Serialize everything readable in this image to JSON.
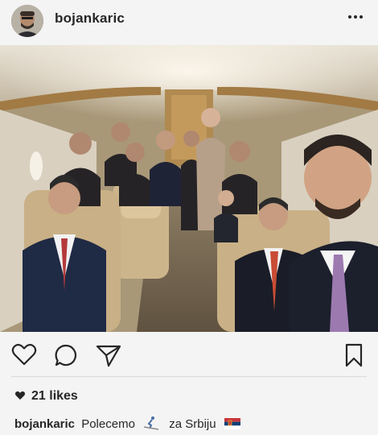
{
  "post": {
    "username": "bojankaric",
    "more_icon": "ellipsis-icon",
    "likes_text": "21 likes",
    "caption_user": "bojankaric",
    "caption_text_1": "Polecemo",
    "caption_text_2": "za Srbiju",
    "caption_emoji_1": "skier-icon",
    "caption_emoji_2": "serbian-flag-icon"
  },
  "actions": {
    "like_icon": "heart-outline-icon",
    "comment_icon": "comment-bubble-icon",
    "share_icon": "paper-plane-icon",
    "save_icon": "bookmark-icon"
  },
  "colors": {
    "text": "#262626",
    "background": "#f4f4f4",
    "divider": "#dadada"
  }
}
